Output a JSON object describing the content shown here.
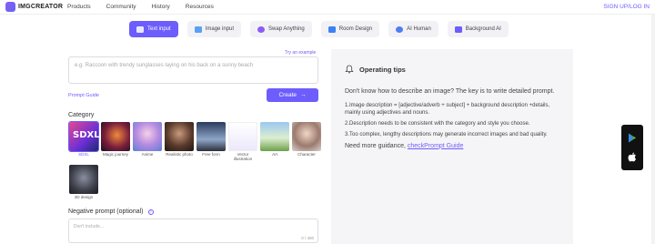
{
  "brand": {
    "name": "IMGCREATOR"
  },
  "nav": {
    "items": [
      "Products",
      "Community",
      "History",
      "Resources"
    ],
    "signup": "SIGN UP/LOG IN"
  },
  "modes": [
    {
      "label": "Text input",
      "active": true,
      "icon": "text-input-icon"
    },
    {
      "label": "Image input",
      "active": false,
      "icon": "image-input-icon"
    },
    {
      "label": "Swap Anything",
      "active": false,
      "icon": "swap-icon"
    },
    {
      "label": "Room Design",
      "active": false,
      "icon": "room-icon"
    },
    {
      "label": "AI Human",
      "active": false,
      "icon": "human-icon"
    },
    {
      "label": "Background AI",
      "active": false,
      "icon": "background-icon"
    }
  ],
  "prompt": {
    "try_example": "Try an example",
    "placeholder": "e.g. Raccoon with trendy sunglasses laying on his back on a sunny beach",
    "guide_link": "Prompt Guide",
    "create_label": "Create"
  },
  "category": {
    "title": "Category",
    "items": [
      {
        "label": "SDXL",
        "selected": true
      },
      {
        "label": "Magic journey",
        "selected": false
      },
      {
        "label": "Anime",
        "selected": false
      },
      {
        "label": "Realistic photo",
        "selected": false
      },
      {
        "label": "Free form",
        "selected": false
      },
      {
        "label": "Vector illustration",
        "selected": false
      },
      {
        "label": "Art",
        "selected": false
      },
      {
        "label": "Character",
        "selected": false
      },
      {
        "label": "3D design",
        "selected": false
      }
    ]
  },
  "negative": {
    "title": "Negative prompt (optional)",
    "placeholder": "Don't include...",
    "counter": "0 / 400"
  },
  "tips": {
    "title": "Operating tips",
    "intro": "Don't know how to describe an image? The key is to write detailed prompt.",
    "tip1": "1.Image description = [adjective/adverb + subject] + background description +details, mainly using adjectives and nouns.",
    "tip2": "2.Description needs to be consistent with the category and style you choose.",
    "tip3": "3.Too complex, lengthy descriptions may generate incorrect images and bad quality.",
    "more": "Need more guidance,",
    "more_link": "checkPrompt Guide"
  },
  "colors": {
    "accent": "#6d5dfc"
  }
}
